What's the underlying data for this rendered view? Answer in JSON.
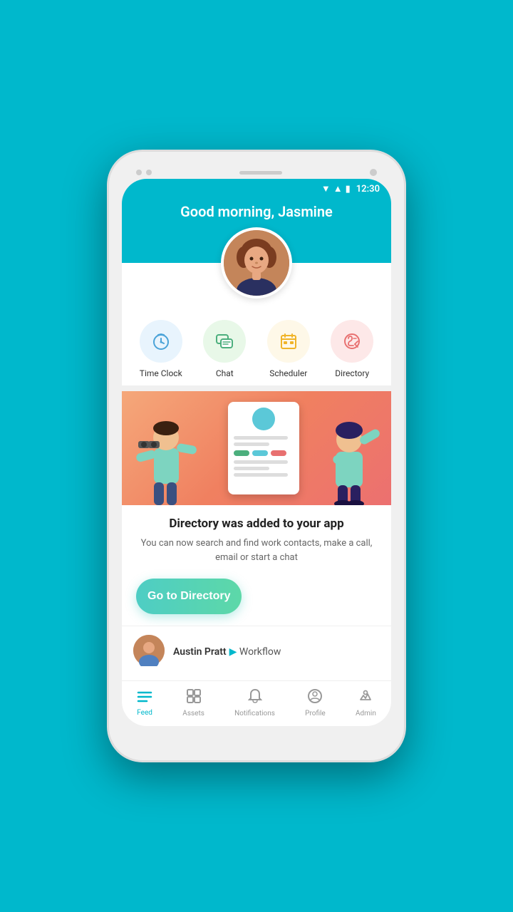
{
  "statusBar": {
    "time": "12:30"
  },
  "header": {
    "greeting": "Good morning, Jasmine"
  },
  "quickActions": [
    {
      "id": "time-clock",
      "label": "Time Clock",
      "icon": "⏱",
      "colorClass": "icon-timeclock"
    },
    {
      "id": "chat",
      "label": "Chat",
      "icon": "💬",
      "colorClass": "icon-chat"
    },
    {
      "id": "scheduler",
      "label": "Scheduler",
      "icon": "📅",
      "colorClass": "icon-scheduler"
    },
    {
      "id": "directory",
      "label": "Directory",
      "icon": "📞",
      "colorClass": "icon-directory"
    }
  ],
  "banner": {
    "title": "Directory was added to your app",
    "description": "You can now search and find work contacts, make a call, email or start a chat",
    "buttonLabel": "Go to Directory"
  },
  "activity": {
    "name": "Austin Pratt",
    "action": "Workflow"
  },
  "bottomNav": [
    {
      "id": "feed",
      "label": "Feed",
      "icon": "☰",
      "active": true
    },
    {
      "id": "assets",
      "label": "Assets",
      "icon": "⊞",
      "active": false
    },
    {
      "id": "notifications",
      "label": "Notifications",
      "icon": "🔔",
      "active": false
    },
    {
      "id": "profile",
      "label": "Profile",
      "icon": "👤",
      "active": false
    },
    {
      "id": "admin",
      "label": "Admin",
      "icon": "👑",
      "active": false
    }
  ]
}
